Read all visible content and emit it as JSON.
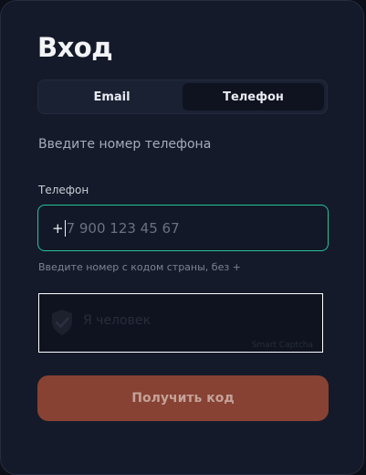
{
  "login": {
    "title": "Вход",
    "tabs": [
      {
        "label": "Email",
        "active": false
      },
      {
        "label": "Телефон",
        "active": true
      }
    ],
    "subtitle": "Введите номер телефона",
    "phone": {
      "label": "Телефон",
      "prefix": "+",
      "value": "",
      "placeholder": "7 900 123 45 67",
      "hint": "Введите номер с кодом страны, без +"
    },
    "captcha": {
      "label": "Я человек",
      "brand": "Smart Captcha",
      "icon": "shield-check-icon"
    },
    "submit_label": "Получить код"
  },
  "colors": {
    "accent_border": "#26c497",
    "submit_bg": "#874233",
    "card_bg": "#141a29"
  }
}
